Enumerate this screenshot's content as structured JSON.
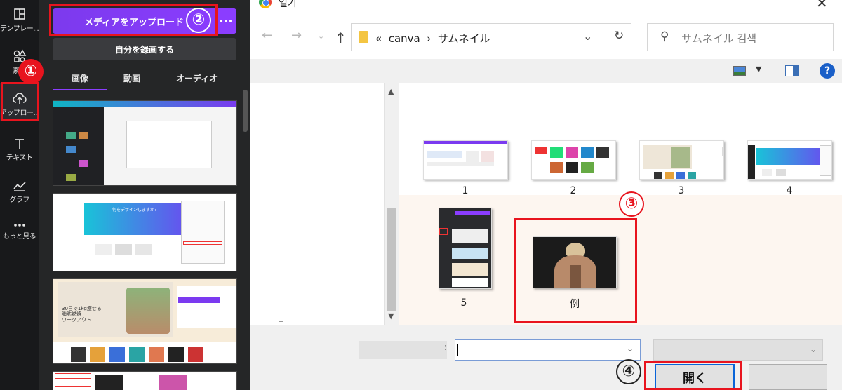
{
  "rail": {
    "templates": "テンプレー...",
    "elements": "素材",
    "uploads": "アップロー...",
    "text": "テキスト",
    "charts": "グラフ",
    "more": "もっと見る"
  },
  "panel": {
    "upload_label": "メディアをアップロード",
    "more_label": "•••",
    "record_label": "自分を録画する",
    "tabs": [
      "画像",
      "動画",
      "オーディオ"
    ]
  },
  "thumb_texts": {
    "t2_title": "何をデザインしますか？",
    "t3_title": "30日で1kg痩せる\n脂肪燃焼\nワークアウト"
  },
  "dialog": {
    "title": "열기",
    "close": "✕",
    "path_prefix": "«",
    "path_folder": "canva",
    "path_sep": "›",
    "path_current": "サムネイル",
    "search_placeholder": "サムネイル 검색",
    "help": "?",
    "files": [
      {
        "name": "1"
      },
      {
        "name": "2"
      },
      {
        "name": "3"
      },
      {
        "name": "4"
      },
      {
        "name": "5"
      },
      {
        "name": "例"
      }
    ],
    "open_button": "開く",
    "filename_colon": ":"
  },
  "annotations": [
    "①",
    "②",
    "③",
    "④"
  ],
  "colors": {
    "canva_purple": "#8b3dff",
    "annotation_red": "#e8141e",
    "canva_dark": "#252627",
    "windows_blue": "#0a64d8"
  }
}
